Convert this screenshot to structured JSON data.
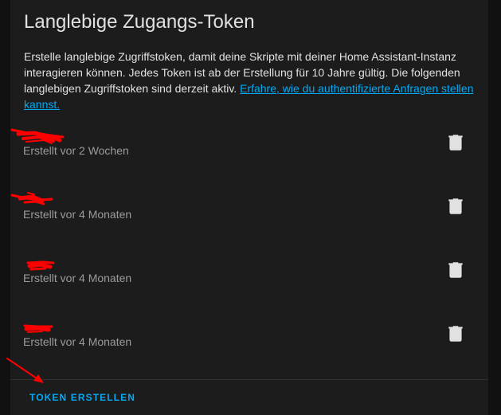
{
  "card": {
    "title": "Langlebige Zugangs-Token",
    "description": "Erstelle langlebige Zugriffstoken, damit deine Skripte mit deiner Home Assistant-Instanz interagieren können. Jedes Token ist ab der Erstellung für 10 Jahre gültig. Die folgenden langlebigen Zugriffstoken sind derzeit aktiv. ",
    "link_text": "Erfahre, wie du authentifizierte Anfragen stellen kannst."
  },
  "tokens": [
    {
      "subtext": "Erstellt vor 2 Wochen",
      "delete_icon": "trash-can-icon"
    },
    {
      "subtext": "Erstellt vor 4 Monaten",
      "delete_icon": "trash-can-icon"
    },
    {
      "subtext": "Erstellt vor 4 Monaten",
      "delete_icon": "trash-can-icon"
    },
    {
      "subtext": "Erstellt vor 4 Monaten",
      "delete_icon": "trash-can-icon"
    }
  ],
  "actions": {
    "create_label": "TOKEN ERSTELLEN"
  },
  "colors": {
    "background": "#111111",
    "card": "#1c1c1c",
    "text": "#e1e1e1",
    "secondary_text": "#9b9b9b",
    "accent": "#03a9f4",
    "redaction": "#ff0000",
    "icon": "#e1e1e1"
  }
}
